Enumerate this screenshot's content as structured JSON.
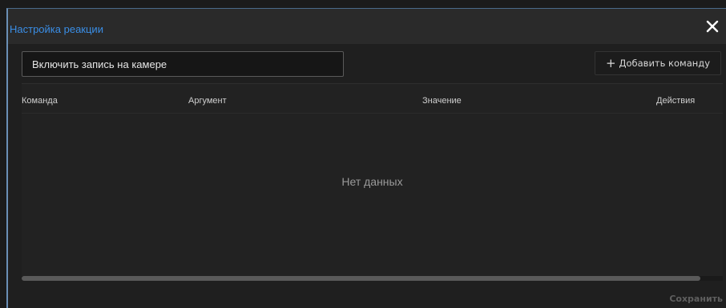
{
  "dialog": {
    "title": "Настройка реакции",
    "close_icon": "close-icon"
  },
  "reaction": {
    "name_value": "Включить запись на камере"
  },
  "toolbar": {
    "add_command_icon": "plus-icon",
    "add_command_label": "Добавить команду"
  },
  "table": {
    "columns": [
      "Команда",
      "Аргумент",
      "Значение",
      "Действия"
    ],
    "rows": [],
    "empty_text": "Нет данных"
  },
  "footer": {
    "save_label": "Сохранить"
  },
  "colors": {
    "accent": "#3a8ee6",
    "background": "#1f1f1f",
    "header": "#2a2a2a",
    "disabled_text": "#5f5f5f"
  }
}
